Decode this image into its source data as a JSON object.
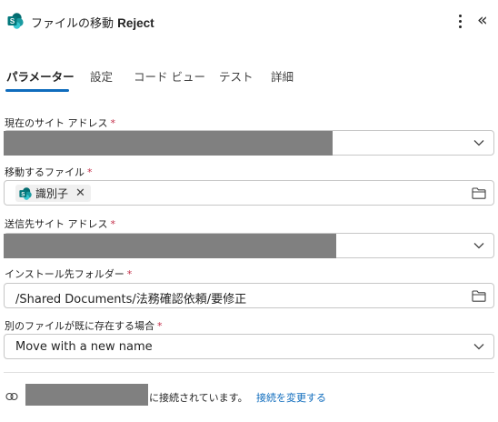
{
  "header": {
    "title_prefix": "ファイルの移動 ",
    "title_strong": "Reject",
    "logo_icon": "sharepoint-logo-icon",
    "more_icon": "more-vertical-icon",
    "collapse_icon": "collapse-panel-icon",
    "collapse_glyph": "«"
  },
  "tabs": [
    {
      "label": "パラメーター",
      "active": true
    },
    {
      "label": "設定",
      "active": false
    },
    {
      "label": "コード ビュー",
      "active": false
    },
    {
      "label": "テスト",
      "active": false
    },
    {
      "label": "詳細",
      "active": false
    }
  ],
  "fields": {
    "current_site": {
      "label": "現在のサイト アドレス",
      "required": "*",
      "value_redacted": true
    },
    "file_to_move": {
      "label": "移動するファイル",
      "required": "*",
      "chip_label": "識別子",
      "chip_remove": "✕"
    },
    "destination_site": {
      "label": "送信先サイト アドレス",
      "required": "*",
      "value_redacted": true
    },
    "destination_folder": {
      "label": "インストール先フォルダー",
      "required": "*",
      "value": "/Shared Documents/法務確認依頼/要修正"
    },
    "if_exists": {
      "label": "別のファイルが既に存在する場合",
      "required": "*",
      "value": "Move with a new name"
    }
  },
  "footer": {
    "connected_text": "に接続されています。",
    "change_connection_link": "接続を変更する",
    "icon": "connection-link-icon"
  },
  "colors": {
    "accent": "#0f6cbd",
    "required": "#c4314b",
    "redaction": "#808080",
    "sharepoint_dark": "#036c70",
    "sharepoint_mid": "#1a9ba1",
    "sharepoint_light": "#37c6d0"
  }
}
